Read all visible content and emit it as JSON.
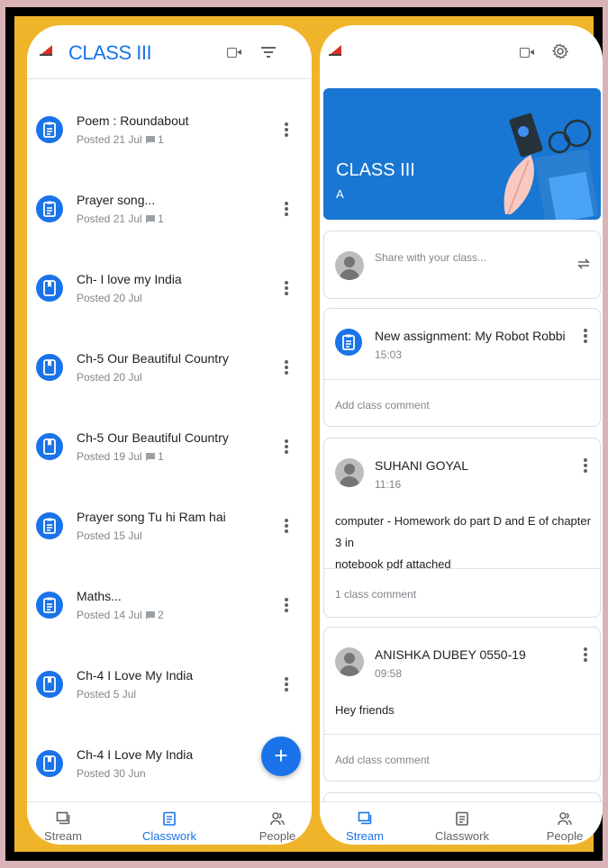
{
  "left_screen": {
    "header": {
      "title": "CLASS III"
    },
    "classwork_items": [
      {
        "title": "Poem : Roundabout",
        "posted": "Posted 21 Jul",
        "comments": "1",
        "type": "assignment"
      },
      {
        "title": "Prayer song...",
        "posted": "Posted 21 Jul",
        "comments": "1",
        "type": "assignment"
      },
      {
        "title": "Ch- I love my India",
        "posted": "Posted 20 Jul",
        "comments": "",
        "type": "material"
      },
      {
        "title": "Ch-5 Our Beautiful Country",
        "posted": "Posted 20 Jul",
        "comments": "",
        "type": "material"
      },
      {
        "title": "Ch-5 Our Beautiful Country",
        "posted": "Posted 19 Jul",
        "comments": "1",
        "type": "material"
      },
      {
        "title": "Prayer song Tu hi Ram hai",
        "posted": "Posted 15 Jul",
        "comments": "",
        "type": "assignment"
      },
      {
        "title": "Maths...",
        "posted": "Posted 14 Jul",
        "comments": "2",
        "type": "assignment"
      },
      {
        "title": "Ch-4 I Love My India",
        "posted": "Posted 5 Jul",
        "comments": "",
        "type": "material"
      },
      {
        "title": "Ch-4 I Love My India",
        "posted": "Posted 30 Jun",
        "comments": "",
        "type": "material"
      }
    ],
    "fab_label": "+",
    "nav": {
      "stream": "Stream",
      "classwork": "Classwork",
      "people": "People"
    }
  },
  "right_screen": {
    "banner": {
      "title": "CLASS III",
      "section": "A"
    },
    "share": {
      "placeholder": "Share with your class..."
    },
    "posts": [
      {
        "title": "New assignment: My Robot Robbi",
        "time": "15:03",
        "footer": "Add class comment"
      },
      {
        "author": "SUHANI GOYAL",
        "time": "11:16",
        "body_line1": "computer - Homework do part D and E of chapter 3 in",
        "body_line2": "notebook pdf attached",
        "footer": "1 class comment"
      },
      {
        "author": "ANISHKA DUBEY 0550-19",
        "time": "09:58",
        "body": "Hey friends",
        "footer": "Add class comment"
      }
    ],
    "nav": {
      "stream": "Stream",
      "classwork": "Classwork",
      "people": "People"
    }
  },
  "colors": {
    "accent": "#1a73e8",
    "frame_gold": "#f0b42a",
    "banner": "#1976d2"
  }
}
